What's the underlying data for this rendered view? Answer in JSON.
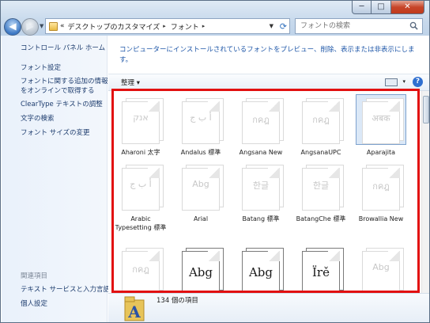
{
  "window": {
    "minimize": "─",
    "maximize": "□",
    "close": "✕"
  },
  "nav": {
    "back": "◀",
    "forward": "▶"
  },
  "address": {
    "prefix": "«",
    "crumbs": [
      "デスクトップのカスタマイズ",
      "フォント"
    ],
    "separator": "▸"
  },
  "search": {
    "placeholder": "フォントの検索"
  },
  "sidebar": {
    "links": [
      "コントロール パネル ホーム",
      "フォント設定",
      "フォントに関する追加の情報",
      "をオンラインで取得する",
      "ClearType テキストの調整",
      "文字の検索",
      "フォント サイズの変更"
    ],
    "related_heading": "関連項目",
    "related_links": [
      "テキスト サービスと入力言語",
      "個人設定"
    ]
  },
  "content": {
    "description": "コンピューターにインストールされているフォントをプレビュー、削除、表示または非表示にします。",
    "organize": "整理 ▾",
    "help": "?",
    "view_drop": "▾"
  },
  "fonts": [
    {
      "name": "Aharoni 太字",
      "sample": "אנק"
    },
    {
      "name": "Andalus 標準",
      "sample": "أ ب ج"
    },
    {
      "name": "Angsana New",
      "sample": "กคฎ"
    },
    {
      "name": "AngsanaUPC",
      "sample": "กคฎ"
    },
    {
      "name": "Aparajita",
      "sample": "अबक"
    },
    {
      "name": "Arabic Typesetting 標準",
      "sample": "أ ب ج"
    },
    {
      "name": "Arial",
      "sample": "Abg"
    },
    {
      "name": "Batang 標準",
      "sample": "한글"
    },
    {
      "name": "BatangChe 標準",
      "sample": "한글"
    },
    {
      "name": "Browallia New",
      "sample": "กคฎ"
    },
    {
      "name": "",
      "sample": "กคฎ"
    },
    {
      "name": "",
      "sample": "Abg"
    },
    {
      "name": "",
      "sample": "Abg"
    },
    {
      "name": "",
      "sample": "Ïrě"
    },
    {
      "name": "",
      "sample": "Abg"
    }
  ],
  "details": {
    "count": "134 個の項目"
  },
  "colors": {
    "highlight_box": "#e21010",
    "link": "#1f57a8"
  }
}
